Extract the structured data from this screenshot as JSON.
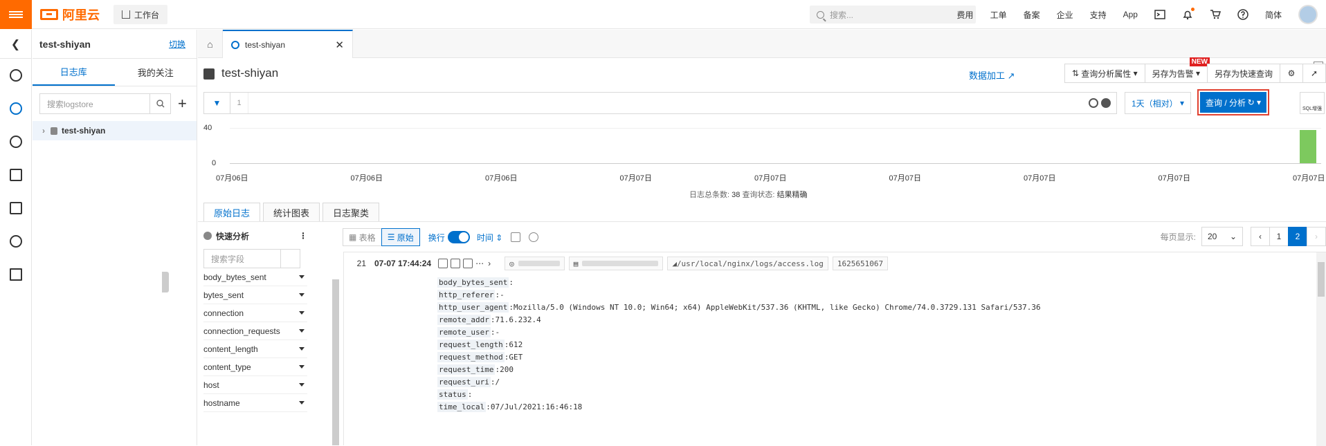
{
  "topbar": {
    "logo_text": "阿里云",
    "workbench": "工作台",
    "search_placeholder": "搜索...",
    "nav": [
      "费用",
      "工单",
      "备案",
      "企业",
      "支持",
      "App"
    ],
    "lang": "简体"
  },
  "sidebar": {
    "title": "test-shiyan",
    "switch": "切换",
    "tabs": [
      "日志库",
      "我的关注"
    ],
    "search_placeholder": "搜索logstore",
    "store": "test-shiyan"
  },
  "tabbar": {
    "active_tab": "test-shiyan"
  },
  "header": {
    "title": "test-shiyan",
    "data_processing": "数据加工",
    "buttons": {
      "query_props": "查询分析属性",
      "save_alert": "另存为告警",
      "new_badge": "NEW",
      "save_quick": "另存为快速查询"
    }
  },
  "query": {
    "line_no": "1",
    "time_range": "1天（相对）",
    "query_btn": "查询 / 分析",
    "sql_btn": "SQL增强"
  },
  "histogram": {
    "y_max": "40",
    "y_min": "0",
    "x_labels": [
      "07月06日",
      "07月06日",
      "07月06日",
      "07月07日",
      "07月07日",
      "07月07日",
      "07月07日",
      "07月07日",
      "07月07日"
    ],
    "last_bar_fraction": 0.95
  },
  "stats": {
    "total_label": "日志总条数:",
    "total": "38",
    "status_label": "查询状态:",
    "status": "结果精确"
  },
  "subtabs": [
    "原始日志",
    "统计图表",
    "日志聚类"
  ],
  "quick": {
    "title": "快速分析",
    "search_placeholder": "搜索字段",
    "fields": [
      "body_bytes_sent",
      "bytes_sent",
      "connection",
      "connection_requests",
      "content_length",
      "content_type",
      "host",
      "hostname"
    ]
  },
  "logtools": {
    "table": "表格",
    "raw": "原始",
    "wrap": "换行",
    "time": "时间",
    "per_page_label": "每页显示:",
    "per_page": "20",
    "pages": [
      "1",
      "2"
    ],
    "current_page": "2"
  },
  "log": {
    "index": "21",
    "time": "07-07 17:44:24",
    "source_path": "/usr/local/nginx/logs/access.log",
    "tag_id": "1625651067",
    "fields": [
      {
        "k": "body_bytes_sent",
        "v": ":"
      },
      {
        "k": "http_referer",
        "v": ":-"
      },
      {
        "k": "http_user_agent",
        "v": ":Mozilla/5.0 (Windows NT 10.0; Win64; x64) AppleWebKit/537.36 (KHTML, like Gecko) Chrome/74.0.3729.131 Safari/537.36"
      },
      {
        "k": "remote_addr",
        "v": ":71.6.232.4"
      },
      {
        "k": "remote_user",
        "v": ":-"
      },
      {
        "k": "request_length",
        "v": ":612"
      },
      {
        "k": "request_method",
        "v": ":GET"
      },
      {
        "k": "request_time",
        "v": ":200"
      },
      {
        "k": "request_uri",
        "v": ":/"
      },
      {
        "k": "status",
        "v": ":"
      },
      {
        "k": "time_local",
        "v": ":07/Jul/2021:16:46:18"
      }
    ]
  }
}
